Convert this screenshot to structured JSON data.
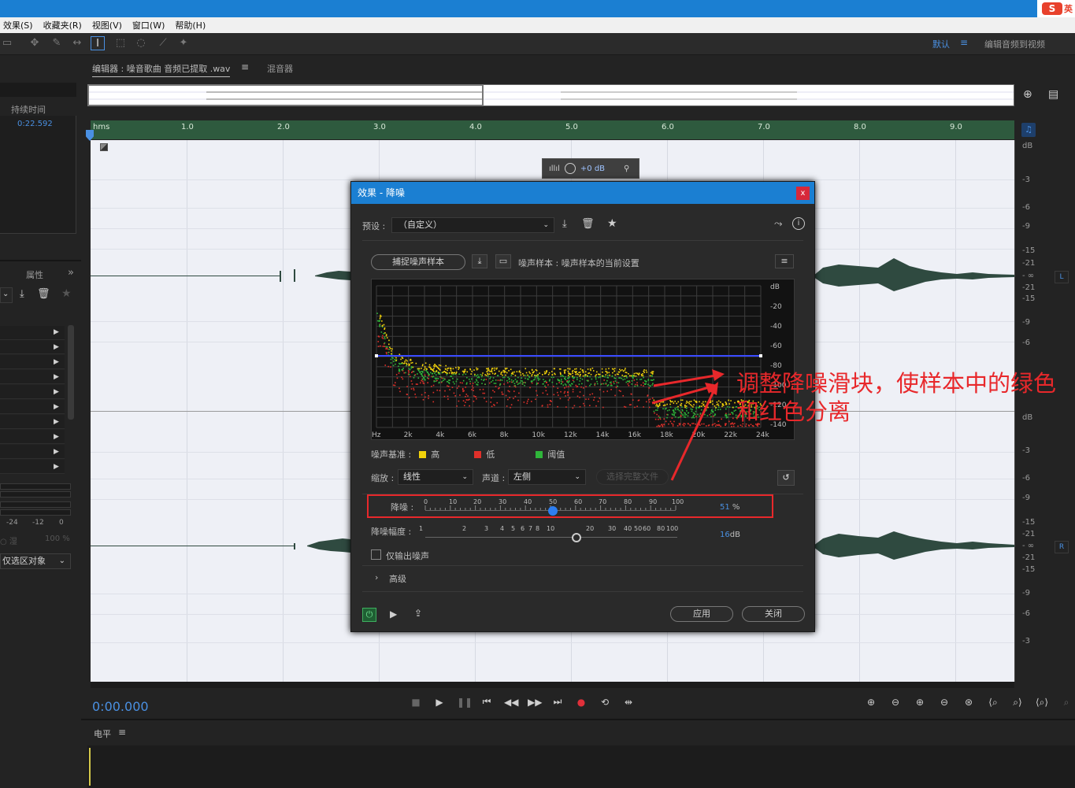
{
  "ime": {
    "logo": "S",
    "mode": "英"
  },
  "menu": {
    "items": [
      "效果(S)",
      "收藏夹(R)",
      "视图(V)",
      "窗口(W)",
      "帮助(H)"
    ]
  },
  "workspace": {
    "name": "默认",
    "menu_icon": "hamburger-icon",
    "mode": "编辑音频到视频"
  },
  "left_panel": {
    "duration_header": "持续时间",
    "duration_value": "0:22.592",
    "properties_label": "属性",
    "more_label": "»",
    "meter_scale": [
      "-24",
      "-12",
      "0"
    ],
    "dim_left": "○ 湿",
    "dim_right": "100 %",
    "selection_mode": "仅选区对象",
    "chevron": "⌄"
  },
  "editor": {
    "tab_label": "编辑器 : 噪音歌曲 音频已提取 .wav",
    "tab_menu": "≡",
    "mixer_label": "混音器",
    "ruler_unit": "hms",
    "ruler_labels": [
      "1.0",
      "2.0",
      "3.0",
      "4.0",
      "5.0",
      "6.0",
      "7.0",
      "8.0",
      "9.0"
    ],
    "db_labels_top": [
      "dB",
      "-3",
      "-6",
      "-9",
      "-15",
      "-21",
      "- ∞",
      "-21",
      "-15",
      "-9",
      "-6"
    ],
    "db_labels_bottom": [
      "dB",
      "-3",
      "-6",
      "-9",
      "-15",
      "-21",
      "- ∞",
      "-21",
      "-15",
      "-9",
      "-6",
      "-3"
    ],
    "channel_left": "L",
    "channel_right": "R",
    "hud_gain": "+0 dB",
    "current_time": "0:00.000"
  },
  "level_panel": {
    "label": "电平",
    "menu": "≡"
  },
  "dialog": {
    "title": "效果 - 降噪",
    "close": "x",
    "preset_label": "预设 :",
    "preset_value": "（自定义）",
    "capture_button": "捕捉噪声样本",
    "sample_label": "噪声样本 : 噪声样本的当前设置",
    "spectrum": {
      "db_labels": [
        "dB",
        "-20",
        "-40",
        "-60",
        "-80",
        "-100",
        "-120",
        "-140"
      ],
      "freq_labels": [
        "Hz",
        "2k",
        "4k",
        "6k",
        "8k",
        "10k",
        "12k",
        "14k",
        "16k",
        "18k",
        "20k",
        "22k",
        "24k"
      ]
    },
    "legend_label": "噪声基准 :",
    "legend": [
      {
        "name": "高",
        "color": "#f2d20a"
      },
      {
        "name": "低",
        "color": "#e0302a"
      },
      {
        "name": "阈值",
        "color": "#2fb53a"
      }
    ],
    "scale_label": "缩放 :",
    "scale_value": "线性",
    "channel_label": "声道 :",
    "channel_value": "左侧",
    "select_file_button": "选择完整文件",
    "reduction_label": "降噪 :",
    "reduction_ticks": [
      "0",
      "10",
      "20",
      "30",
      "40",
      "50",
      "60",
      "70",
      "80",
      "90",
      "100"
    ],
    "reduction_value": "51",
    "reduction_unit": "%",
    "amount_label": "降噪幅度 :",
    "amount_ticks": [
      "1",
      "2",
      "3",
      "4",
      "5",
      "6",
      "7",
      "8",
      "10",
      "20",
      "30",
      "40",
      "50",
      "60",
      "80",
      "100"
    ],
    "amount_value": "16",
    "amount_unit": "dB",
    "output_noise_label": "仅输出噪声",
    "advanced_label": "高级",
    "apply_button": "应用",
    "close_button": "关闭"
  },
  "annotation": "调整降噪滑块，使样本中的绿色和红色分离",
  "colors": {
    "accent": "#4a90e2",
    "titlebar": "#1b7fd2",
    "annotation": "#e8282b",
    "waveform": "#2f4a40"
  }
}
